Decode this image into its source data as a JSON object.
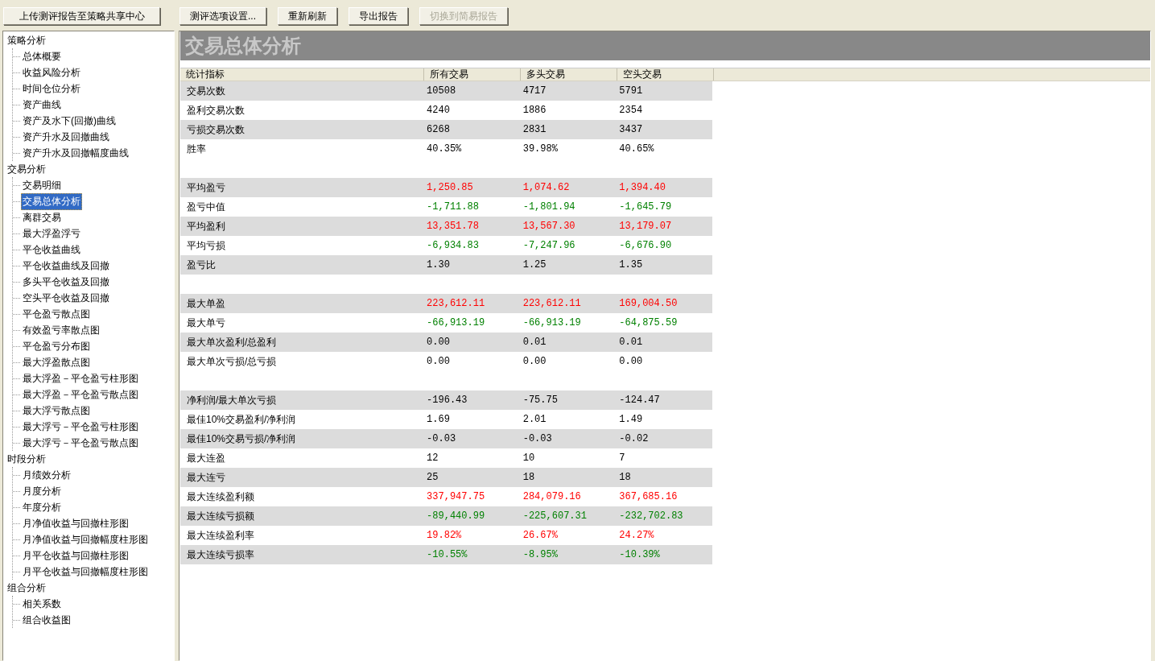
{
  "toolbar": {
    "buttons": [
      {
        "label": "上传测评报告至策略共享中心",
        "disabled": false
      },
      {
        "label": "测评选项设置...",
        "disabled": false
      },
      {
        "label": "重新刷新",
        "disabled": false
      },
      {
        "label": "导出报告",
        "disabled": false
      },
      {
        "label": "切换到简易报告",
        "disabled": true
      }
    ]
  },
  "sidebar": {
    "tree": [
      {
        "label": "策略分析",
        "selected": false,
        "children": [
          {
            "label": "总体概要",
            "selected": false
          },
          {
            "label": "收益风险分析",
            "selected": false
          },
          {
            "label": "时间仓位分析",
            "selected": false
          },
          {
            "label": "资产曲线",
            "selected": false
          },
          {
            "label": "资产及水下(回撤)曲线",
            "selected": false
          },
          {
            "label": "资产升水及回撤曲线",
            "selected": false
          },
          {
            "label": "资产升水及回撤幅度曲线",
            "selected": false
          }
        ]
      },
      {
        "label": "交易分析",
        "selected": false,
        "children": [
          {
            "label": "交易明细",
            "selected": false
          },
          {
            "label": "交易总体分析",
            "selected": true
          },
          {
            "label": "离群交易",
            "selected": false
          },
          {
            "label": "最大浮盈浮亏",
            "selected": false
          },
          {
            "label": "平仓收益曲线",
            "selected": false
          },
          {
            "label": "平仓收益曲线及回撤",
            "selected": false
          },
          {
            "label": "多头平仓收益及回撤",
            "selected": false
          },
          {
            "label": "空头平仓收益及回撤",
            "selected": false
          },
          {
            "label": "平仓盈亏散点图",
            "selected": false
          },
          {
            "label": "有效盈亏率散点图",
            "selected": false
          },
          {
            "label": "平仓盈亏分布图",
            "selected": false
          },
          {
            "label": "最大浮盈散点图",
            "selected": false
          },
          {
            "label": "最大浮盈－平仓盈亏柱形图",
            "selected": false
          },
          {
            "label": "最大浮盈－平仓盈亏散点图",
            "selected": false
          },
          {
            "label": "最大浮亏散点图",
            "selected": false
          },
          {
            "label": "最大浮亏－平仓盈亏柱形图",
            "selected": false
          },
          {
            "label": "最大浮亏－平仓盈亏散点图",
            "selected": false
          }
        ]
      },
      {
        "label": "时段分析",
        "selected": false,
        "children": [
          {
            "label": "月绩效分析",
            "selected": false
          },
          {
            "label": "月度分析",
            "selected": false
          },
          {
            "label": "年度分析",
            "selected": false
          },
          {
            "label": "月净值收益与回撤柱形图",
            "selected": false
          },
          {
            "label": "月净值收益与回撤幅度柱形图",
            "selected": false
          },
          {
            "label": "月平仓收益与回撤柱形图",
            "selected": false
          },
          {
            "label": "月平仓收益与回撤幅度柱形图",
            "selected": false
          }
        ]
      },
      {
        "label": "组合分析",
        "selected": false,
        "children": [
          {
            "label": "相关系数",
            "selected": false
          },
          {
            "label": "组合收益图",
            "selected": false
          }
        ]
      }
    ]
  },
  "report": {
    "title": "交易总体分析",
    "table": {
      "columns": [
        "统计指标",
        "所有交易",
        "多头交易",
        "空头交易"
      ],
      "groups": [
        {
          "rows": [
            {
              "kind": "neutral",
              "cells": [
                "交易次数",
                "10508",
                "4717",
                "5791"
              ]
            },
            {
              "kind": "neutral",
              "cells": [
                "盈利交易次数",
                "4240",
                "1886",
                "2354"
              ]
            },
            {
              "kind": "neutral",
              "cells": [
                "亏损交易次数",
                "6268",
                "2831",
                "3437"
              ]
            },
            {
              "kind": "neutral",
              "cells": [
                "胜率",
                "40.35%",
                "39.98%",
                "40.65%"
              ]
            }
          ]
        },
        {
          "rows": [
            {
              "kind": "profit",
              "cells": [
                "平均盈亏",
                "1,250.85",
                "1,074.62",
                "1,394.40"
              ]
            },
            {
              "kind": "loss",
              "cells": [
                "盈亏中值",
                "-1,711.88",
                "-1,801.94",
                "-1,645.79"
              ]
            },
            {
              "kind": "profit",
              "cells": [
                "平均盈利",
                "13,351.78",
                "13,567.30",
                "13,179.07"
              ]
            },
            {
              "kind": "loss",
              "cells": [
                "平均亏损",
                "-6,934.83",
                "-7,247.96",
                "-6,676.90"
              ]
            },
            {
              "kind": "neutral",
              "cells": [
                "盈亏比",
                "1.30",
                "1.25",
                "1.35"
              ]
            }
          ]
        },
        {
          "rows": [
            {
              "kind": "profit",
              "cells": [
                "最大单盈",
                "223,612.11",
                "223,612.11",
                "169,004.50"
              ]
            },
            {
              "kind": "loss",
              "cells": [
                "最大单亏",
                "-66,913.19",
                "-66,913.19",
                "-64,875.59"
              ]
            },
            {
              "kind": "neutral",
              "cells": [
                "最大单次盈利/总盈利",
                "0.00",
                "0.01",
                "0.01"
              ]
            },
            {
              "kind": "neutral",
              "cells": [
                "最大单次亏损/总亏损",
                "0.00",
                "0.00",
                "0.00"
              ]
            }
          ]
        },
        {
          "rows": [
            {
              "kind": "neutral",
              "cells": [
                "净利润/最大单次亏损",
                "-196.43",
                "-75.75",
                "-124.47"
              ]
            },
            {
              "kind": "neutral",
              "cells": [
                "最佳10%交易盈利/净利润",
                "1.69",
                "2.01",
                "1.49"
              ]
            },
            {
              "kind": "neutral",
              "cells": [
                "最佳10%交易亏损/净利润",
                "-0.03",
                "-0.03",
                "-0.02"
              ]
            },
            {
              "kind": "neutral",
              "cells": [
                "最大连盈",
                "12",
                "10",
                "7"
              ]
            },
            {
              "kind": "neutral",
              "cells": [
                "最大连亏",
                "25",
                "18",
                "18"
              ]
            },
            {
              "kind": "profit",
              "cells": [
                "最大连续盈利额",
                "337,947.75",
                "284,079.16",
                "367,685.16"
              ]
            },
            {
              "kind": "loss",
              "cells": [
                "最大连续亏损额",
                "-89,440.99",
                "-225,607.31",
                "-232,702.83"
              ]
            },
            {
              "kind": "profit",
              "cells": [
                "最大连续盈利率",
                "19.82%",
                "26.67%",
                "24.27%"
              ]
            },
            {
              "kind": "loss",
              "cells": [
                "最大连续亏损率",
                "-10.55%",
                "-8.95%",
                "-10.39%"
              ]
            }
          ]
        }
      ]
    }
  }
}
